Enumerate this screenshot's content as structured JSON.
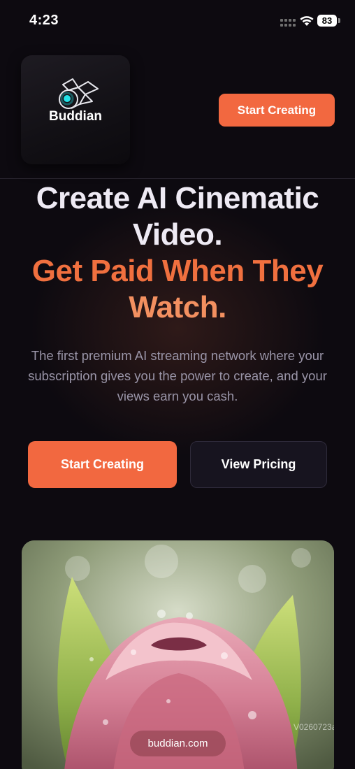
{
  "status_bar": {
    "time": "4:23",
    "battery_level": "83",
    "icons": [
      "signal-icon",
      "wifi-icon",
      "battery-icon"
    ]
  },
  "header": {
    "logo_text": "Buddian",
    "logo_icon": "origami-bird-icon",
    "cta_label": "Start Creating"
  },
  "hero": {
    "title_line1": "Create AI Cinematic",
    "title_line2": "Video.",
    "highlight_line1": "Get Paid When They",
    "highlight_line2": "Watch.",
    "subtitle": "The first premium AI streaming network where your subscription gives you the power to create, and your views earn you cash.",
    "primary_button": "Start Creating",
    "secondary_button": "View Pricing"
  },
  "preview": {
    "watermark": "V0260723a",
    "url_label": "buddian.com"
  },
  "colors": {
    "accent": "#f26840",
    "background": "#0d0a10",
    "secondary_button_bg": "#17141f",
    "subtitle_text": "#9a95a8"
  }
}
